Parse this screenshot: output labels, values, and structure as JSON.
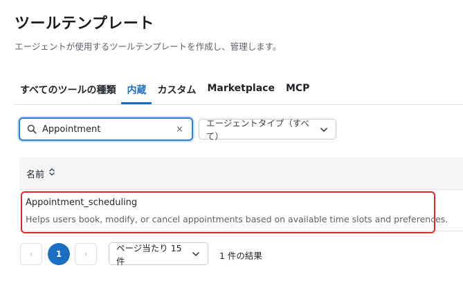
{
  "header": {
    "title": "ツールテンプレート",
    "subtitle": "エージェントが使用するツールテンプレートを作成し、管理します。"
  },
  "tabs": [
    {
      "label": "すべてのツールの種類",
      "active": false
    },
    {
      "label": "内蔵",
      "active": true
    },
    {
      "label": "カスタム",
      "active": false
    },
    {
      "label": "Marketplace",
      "active": false
    },
    {
      "label": "MCP",
      "active": false
    }
  ],
  "search": {
    "value": "Appointment",
    "icon": "search-icon",
    "clear_glyph": "×"
  },
  "filter": {
    "selected": "エージェントタイプ（すべて）"
  },
  "table": {
    "columns": [
      {
        "label": "名前",
        "sortable": true
      }
    ],
    "rows": [
      {
        "name": "Appointment_scheduling",
        "description": "Helps users book, modify, or cancel appointments based on available time slots and preferences."
      }
    ]
  },
  "pagination": {
    "prev_glyph": "‹",
    "current_page": "1",
    "next_glyph": "›",
    "page_size_label": "ページ当たり 15 件",
    "result_count": "1 件の結果"
  },
  "colors": {
    "accent": "#1b6ec2",
    "highlight": "#e0262b"
  }
}
